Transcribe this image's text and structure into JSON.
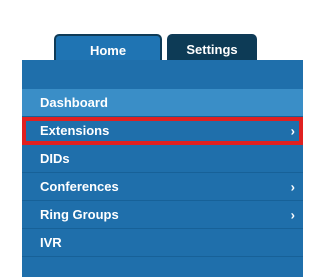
{
  "tabs": {
    "home": "Home",
    "settings": "Settings"
  },
  "menu": {
    "items": [
      {
        "label": "Dashboard",
        "arrow": ""
      },
      {
        "label": "Extensions",
        "arrow": "›"
      },
      {
        "label": "DIDs",
        "arrow": ""
      },
      {
        "label": "Conferences",
        "arrow": "›"
      },
      {
        "label": "Ring Groups",
        "arrow": "›"
      },
      {
        "label": "IVR",
        "arrow": ""
      }
    ]
  },
  "colors": {
    "tab_active": "#1f74b3",
    "tab_inactive": "#0d3b56",
    "sidebar": "#1f6fab",
    "highlight": "#e02020"
  }
}
